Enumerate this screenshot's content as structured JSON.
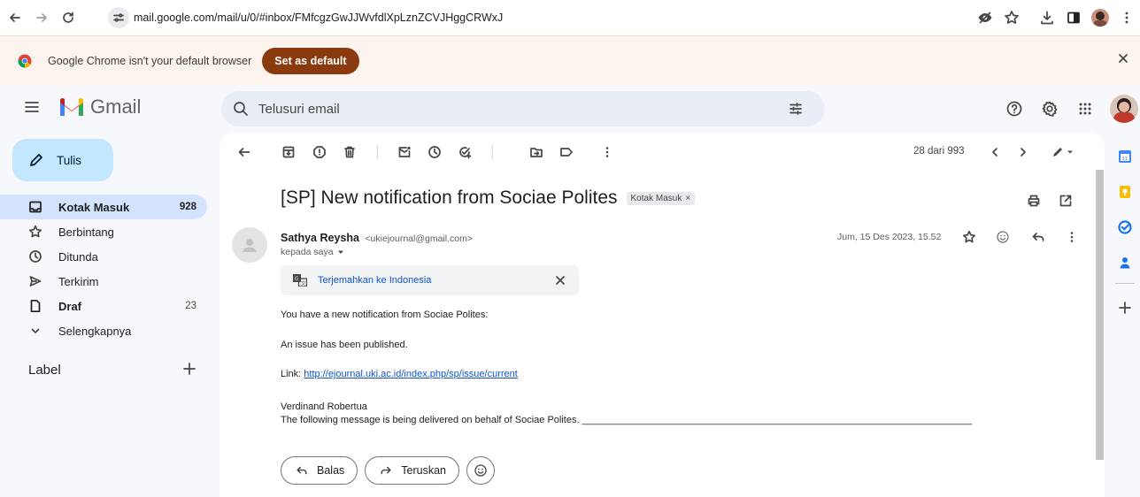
{
  "browser": {
    "url": "mail.google.com/mail/u/0/#inbox/FMfcgzGwJJWvfdlXpLznZCVJHggCRWxJ"
  },
  "infobar": {
    "message": "Google Chrome isn't your default browser",
    "button_label": "Set as default",
    "close_glyph": "×"
  },
  "gmail": {
    "logo_text": "Gmail",
    "search_placeholder": "Telusuri email",
    "compose_label": "Tulis",
    "nav": [
      {
        "label": "Kotak Masuk",
        "count": "928",
        "icon": "inbox-icon"
      },
      {
        "label": "Berbintang",
        "count": "",
        "icon": "star-icon"
      },
      {
        "label": "Ditunda",
        "count": "",
        "icon": "clock-icon"
      },
      {
        "label": "Terkirim",
        "count": "",
        "icon": "send-icon"
      },
      {
        "label": "Draf",
        "count": "23",
        "icon": "draft-icon"
      },
      {
        "label": "Selengkapnya",
        "count": "",
        "icon": "chevron-down-icon"
      }
    ],
    "label_header": "Label",
    "label_add_glyph": "+"
  },
  "toolbar": {
    "pager": "28 dari 993"
  },
  "email": {
    "subject": "[SP] New notification from Sociae Polites",
    "label_badge": "Kotak Masuk",
    "label_badge_close": "×",
    "sender_name": "Sathya Reysha",
    "sender_email": "<ukiejournal@gmail.com>",
    "to": "kepada saya",
    "date": "Jum, 15 Des 2023, 15.52",
    "translate_label": "Terjemahkan ke Indonesia",
    "body": {
      "line1": "You have a new notification from Sociae Polites:",
      "line2": "An issue has been published.",
      "link_prefix": "Link: ",
      "link": "http://ejournal.uki.ac.id/index.php/sp/issue/current",
      "signature_name": "Verdinand Robertua",
      "signature_note": "The following message is being delivered on behalf of Sociae Polites. ________________________________________________________________________"
    },
    "reply_label": "Balas",
    "forward_label": "Teruskan"
  },
  "colors": {
    "compose_bg": "#c2e7ff",
    "active_nav_bg": "#d3e3fd",
    "set_default_bg": "#8a3a0f",
    "gmail_red": "#ea4335",
    "link_blue": "#1155cc"
  }
}
